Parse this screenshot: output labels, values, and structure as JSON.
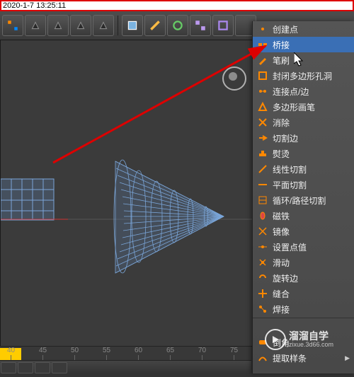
{
  "timestamp": "2020-1-7 13:25:11",
  "timeline": {
    "ticks": [
      40,
      45,
      50,
      55,
      60,
      65,
      70,
      75
    ]
  },
  "menu": {
    "items": [
      {
        "label": "创建点"
      },
      {
        "label": "桥接",
        "selected": true
      },
      {
        "label": "笔刷"
      },
      {
        "label": "封闭多边形孔洞"
      },
      {
        "label": "连接点/边"
      },
      {
        "label": "多边形画笔"
      },
      {
        "label": "消除"
      },
      {
        "label": "切割边"
      },
      {
        "label": "熨烫"
      },
      {
        "label": "线性切割"
      },
      {
        "label": "平面切割"
      },
      {
        "label": "循环/路径切割"
      },
      {
        "label": "磁铁"
      },
      {
        "label": "镜像"
      },
      {
        "label": "设置点值"
      },
      {
        "label": "滑动"
      },
      {
        "label": "旋转边"
      },
      {
        "label": "缝合"
      },
      {
        "label": "焊接"
      },
      {
        "label": ""
      },
      {
        "label": "倒角"
      },
      {
        "label": "提取样条",
        "arrow": true
      }
    ]
  },
  "watermark": {
    "brand": "溜溜自学",
    "url": "zixue.3d66.com"
  }
}
